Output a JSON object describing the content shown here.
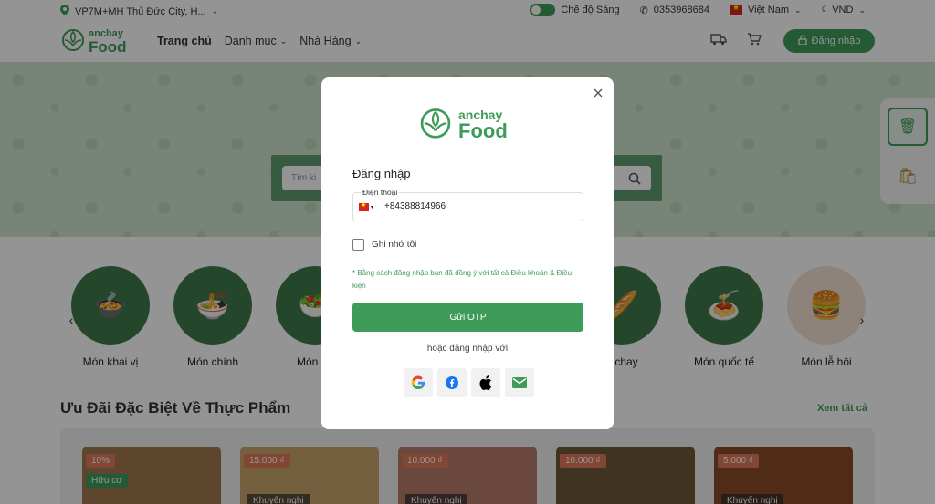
{
  "topbar": {
    "location": "VP7M+MH Thủ Đức City, H...",
    "theme_label": "Chế độ Sáng",
    "phone": "0353968684",
    "language": "Việt Nam",
    "currency_symbol": "₫",
    "currency": "VND"
  },
  "header": {
    "logo_top": "anchay",
    "logo_bottom": "Food",
    "nav": [
      "Trang chủ",
      "Danh mục",
      "Nhà Hàng"
    ],
    "login_label": "Đăng nhập"
  },
  "hero": {
    "search_placeholder": "Tìm ki"
  },
  "categories": [
    {
      "label": "Món khai vị"
    },
    {
      "label": "Món chính"
    },
    {
      "label": "Món ăn"
    },
    {
      "label": "h chay"
    },
    {
      "label": "Món quốc tế"
    },
    {
      "label": "Món lễ hội"
    }
  ],
  "deals": {
    "title": "Ưu Đãi Đặc Biệt Về Thực Phẩm",
    "see_all": "Xem tất cả",
    "cards": [
      {
        "badge": "10%",
        "sub": "Hữu cơ"
      },
      {
        "badge": "15.000 ₫",
        "sub": "Khuyến nghị"
      },
      {
        "badge": "10.000 ₫",
        "sub": "Khuyến nghị"
      },
      {
        "badge": "10.000 ₫",
        "sub": ""
      },
      {
        "badge": "5.000 ₫",
        "sub": "Khuyến nghị"
      }
    ]
  },
  "modal": {
    "logo_top": "anchay",
    "logo_bottom": "Food",
    "title": "Đăng nhập",
    "phone_label": "Điện thoại",
    "phone_value": "+84388814966",
    "remember_label": "Ghi nhớ tôi",
    "terms": "* Bằng cách đăng nhập bạn đã đồng ý với tất cả Điều khoản & Điều kiện",
    "otp_button": "Gửi OTP",
    "or_text": "hoặc đăng nhập với",
    "socials": [
      "google-icon",
      "facebook-icon",
      "apple-icon",
      "email-icon"
    ]
  },
  "colors": {
    "brand": "#3e9b5a",
    "overlay": "rgba(0,0,0,0.42)"
  }
}
